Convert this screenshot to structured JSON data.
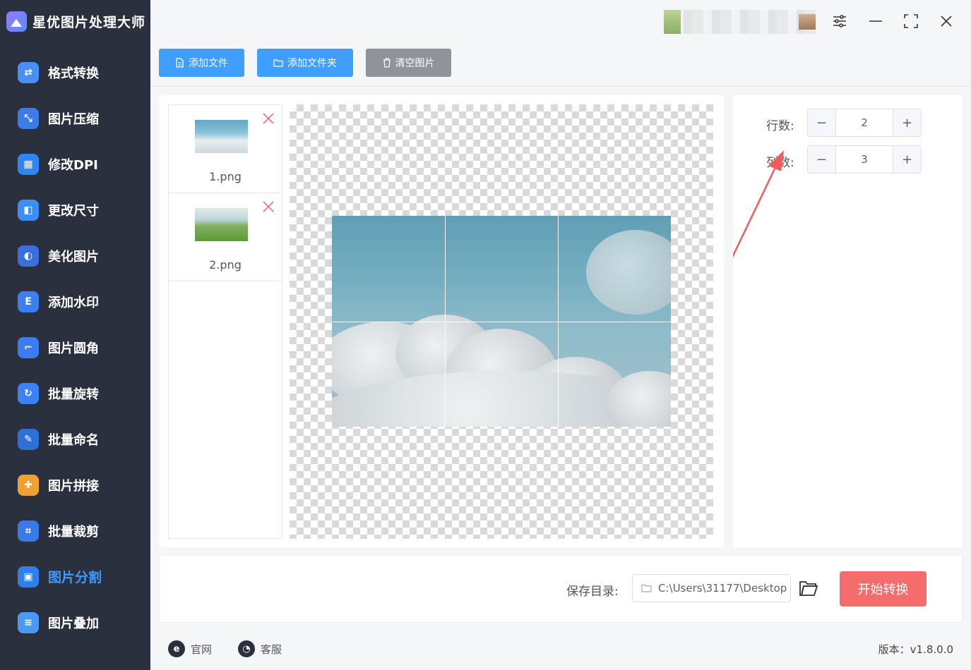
{
  "app": {
    "title": "星优图片处理大师"
  },
  "sidebar": {
    "items": [
      {
        "label": "格式转换",
        "icon": "format-convert-icon",
        "color": "#4a8ff5",
        "glyph": "⇄"
      },
      {
        "label": "图片压缩",
        "icon": "compress-icon",
        "color": "#3a7de8",
        "glyph": "⤡"
      },
      {
        "label": "修改DPI",
        "icon": "dpi-icon",
        "color": "#2f86f0",
        "glyph": "▦"
      },
      {
        "label": "更改尺寸",
        "icon": "resize-icon",
        "color": "#3a8ef5",
        "glyph": "◧"
      },
      {
        "label": "美化图片",
        "icon": "beautify-icon",
        "color": "#3a6fe0",
        "glyph": "◐"
      },
      {
        "label": "添加水印",
        "icon": "watermark-icon",
        "color": "#3e7ff0",
        "glyph": "E"
      },
      {
        "label": "图片圆角",
        "icon": "rounded-corner-icon",
        "color": "#3b7cf2",
        "glyph": "⌐"
      },
      {
        "label": "批量旋转",
        "icon": "rotate-icon",
        "color": "#3b82f5",
        "glyph": "↻"
      },
      {
        "label": "批量命名",
        "icon": "rename-icon",
        "color": "#2e6fd8",
        "glyph": "✎"
      },
      {
        "label": "图片拼接",
        "icon": "stitch-icon",
        "color": "#f0a030",
        "glyph": "✚"
      },
      {
        "label": "批量裁剪",
        "icon": "crop-icon",
        "color": "#3a7ae8",
        "glyph": "⌗"
      },
      {
        "label": "图片分割",
        "icon": "split-icon",
        "color": "#2f80ed",
        "glyph": "▣",
        "active": true
      },
      {
        "label": "图片叠加",
        "icon": "layers-icon",
        "color": "#4a9af5",
        "glyph": "≋"
      }
    ]
  },
  "toolbar": {
    "add_file": "添加文件",
    "add_folder": "添加文件夹",
    "clear": "清空图片"
  },
  "files": [
    {
      "name": "1.png"
    },
    {
      "name": "2.png"
    }
  ],
  "settings": {
    "rows_label": "行数:",
    "rows_value": "2",
    "cols_label": "列数:",
    "cols_value": "3"
  },
  "output": {
    "save_label": "保存目录:",
    "path": "C:\\Users\\31177\\Desktop",
    "start_button": "开始转换"
  },
  "footer": {
    "website": "官网",
    "support": "客服",
    "version": "版本：v1.8.0.0"
  },
  "colors": {
    "primary": "#409eff",
    "danger": "#f56c6c",
    "sidebar_bg": "#2b303e",
    "active_nav": "#3d9bff"
  }
}
